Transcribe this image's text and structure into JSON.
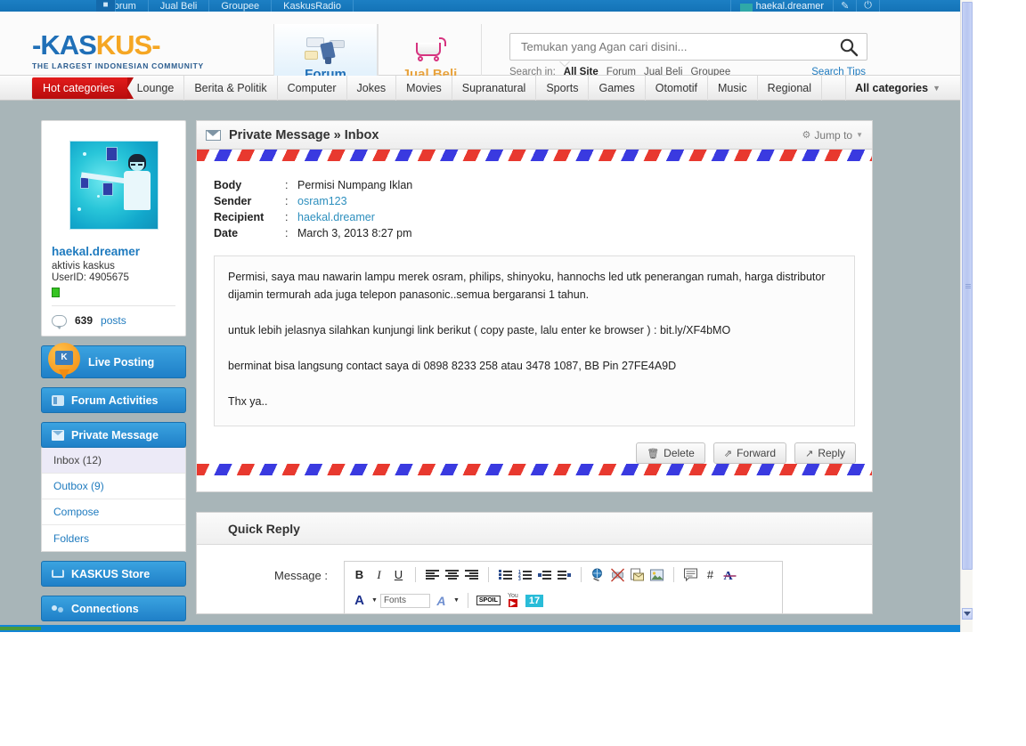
{
  "utilbar": {
    "home_icon": "home-icon",
    "items": [
      "Forum",
      "Jual Beli",
      "Groupee",
      "KaskusRadio"
    ],
    "username": "haekal.dreamer",
    "icons": [
      "pencil-icon",
      "power-icon"
    ]
  },
  "header": {
    "logo": {
      "part1": "KAS",
      "part2": "KUS",
      "dash_left": "-",
      "dash_right": "-",
      "tagline": "THE LARGEST INDONESIAN COMMUNITY"
    },
    "tabs": [
      {
        "label": "Forum",
        "icon": "forum-icon",
        "active": true
      },
      {
        "label": "Jual Beli",
        "icon": "cart-icon",
        "active": false
      }
    ],
    "search": {
      "placeholder": "Temukan yang Agan cari disini...",
      "value": "",
      "icon": "search-icon",
      "search_in_label": "Search in:",
      "scopes": [
        "All Site",
        "Forum",
        "Jual Beli",
        "Groupee"
      ],
      "active_scope": "All Site",
      "tips_label": "Search Tips"
    }
  },
  "categorybar": {
    "hot_label": "Hot categories",
    "items": [
      "Lounge",
      "Berita & Politik",
      "Computer",
      "Jokes",
      "Movies",
      "Supranatural",
      "Sports",
      "Games",
      "Otomotif",
      "Music",
      "Regional"
    ],
    "all_label": "All categories"
  },
  "sidebar": {
    "profile": {
      "avatar": "user-avatar",
      "username": "haekal.dreamer",
      "title": "aktivis kaskus",
      "userid": "UserID: 4905675",
      "status": "online",
      "posts_count": "639",
      "posts_label": "posts"
    },
    "buttons": [
      {
        "label": "Live Posting",
        "icon": "live-posting-icon"
      },
      {
        "label": "Forum Activities",
        "icon": "grid-icon"
      },
      {
        "label": "Private Message",
        "icon": "mail-icon"
      }
    ],
    "pm_submenu": [
      {
        "label": "Inbox (12)",
        "active": true
      },
      {
        "label": "Outbox (9)",
        "active": false
      },
      {
        "label": "Compose",
        "active": false
      },
      {
        "label": "Folders",
        "active": false
      }
    ],
    "bottom_buttons": [
      {
        "label": "KASKUS Store",
        "icon": "cart-icon"
      },
      {
        "label": "Connections",
        "icon": "connections-icon"
      }
    ]
  },
  "main": {
    "header": {
      "icon": "envelope-icon",
      "title": "Private Message » Inbox",
      "jump_to": "Jump to",
      "gear_icon": "gear-icon",
      "caret_icon": "chevron-down-icon"
    },
    "message": {
      "fields": [
        {
          "label": "Body",
          "colon": ":",
          "value": "Permisi Numpang Iklan",
          "link": false
        },
        {
          "label": "Sender",
          "colon": ":",
          "value": "osram123",
          "link": true
        },
        {
          "label": "Recipient",
          "colon": ":",
          "value": "haekal.dreamer",
          "link": true
        },
        {
          "label": "Date",
          "colon": ":",
          "value": "March 3, 2013 8:27 pm",
          "link": false
        }
      ],
      "paragraphs": [
        "Permisi, saya mau nawarin lampu merek osram, philips, shinyoku, hannochs led utk penerangan rumah, harga distributor dijamin termurah ada juga telepon panasonic..semua bergaransi 1 tahun.",
        "untuk lebih jelasnya silahkan kunjungi link berikut ( copy paste, lalu enter ke browser ) : bit.ly/XF4bMO",
        "berminat bisa langsung contact saya di 0898 8233 258 atau 3478 1087, BB Pin 27FE4A9D",
        "Thx ya.."
      ]
    },
    "buttons": [
      {
        "label": "Delete",
        "icon": "trash-icon"
      },
      {
        "label": "Forward",
        "icon": "forward-icon"
      },
      {
        "label": "Reply",
        "icon": "reply-icon"
      }
    ],
    "quick_reply": {
      "title": "Quick Reply",
      "message_label": "Message  :",
      "toolbar_row1": [
        {
          "name": "bold-icon",
          "label": "B"
        },
        {
          "name": "italic-icon",
          "label": "I"
        },
        {
          "name": "underline-icon",
          "label": "U"
        },
        {
          "name": "align-left-icon",
          "label": ""
        },
        {
          "name": "align-center-icon",
          "label": ""
        },
        {
          "name": "align-right-icon",
          "label": ""
        },
        {
          "name": "bullet-list-icon",
          "label": ""
        },
        {
          "name": "numbered-list-icon",
          "label": ""
        },
        {
          "name": "indent-icon",
          "label": ""
        },
        {
          "name": "outdent-icon",
          "label": ""
        },
        {
          "name": "insert-link-icon",
          "label": ""
        },
        {
          "name": "remove-link-icon",
          "label": ""
        },
        {
          "name": "insert-email-icon",
          "label": ""
        },
        {
          "name": "insert-image-icon",
          "label": ""
        },
        {
          "name": "quote-icon",
          "label": ""
        },
        {
          "name": "code-icon",
          "label": "#"
        },
        {
          "name": "strike-font-icon",
          "label": ""
        }
      ],
      "toolbar_row2": [
        {
          "name": "font-color-icon",
          "label": "A"
        },
        {
          "name": "fonts-select",
          "label": "Fonts"
        },
        {
          "name": "font-size-icon",
          "label": "A"
        },
        {
          "name": "spoiler-icon",
          "label": "SPOIL"
        },
        {
          "name": "youtube-icon",
          "label": "You"
        },
        {
          "name": "smiley-17-icon",
          "label": "17"
        }
      ]
    }
  },
  "colors": {
    "brand_blue": "#1f6fb7",
    "brand_orange": "#f5a623",
    "accent_red": "#e21b1b",
    "stripe_red": "#e8392f",
    "stripe_blue": "#3a3ae0",
    "link": "#1f7bbf"
  }
}
